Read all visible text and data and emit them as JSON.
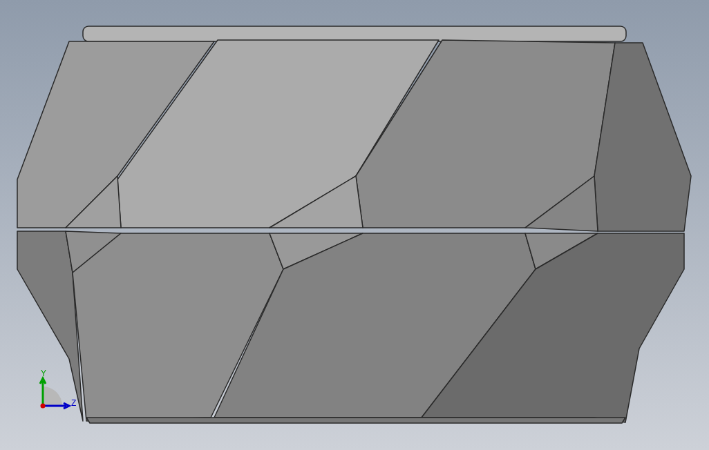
{
  "viewport": {
    "triad": {
      "axes": [
        {
          "label": "Y",
          "color": "#00a000"
        },
        {
          "label": "Z",
          "color": "#0000c8"
        }
      ]
    }
  }
}
